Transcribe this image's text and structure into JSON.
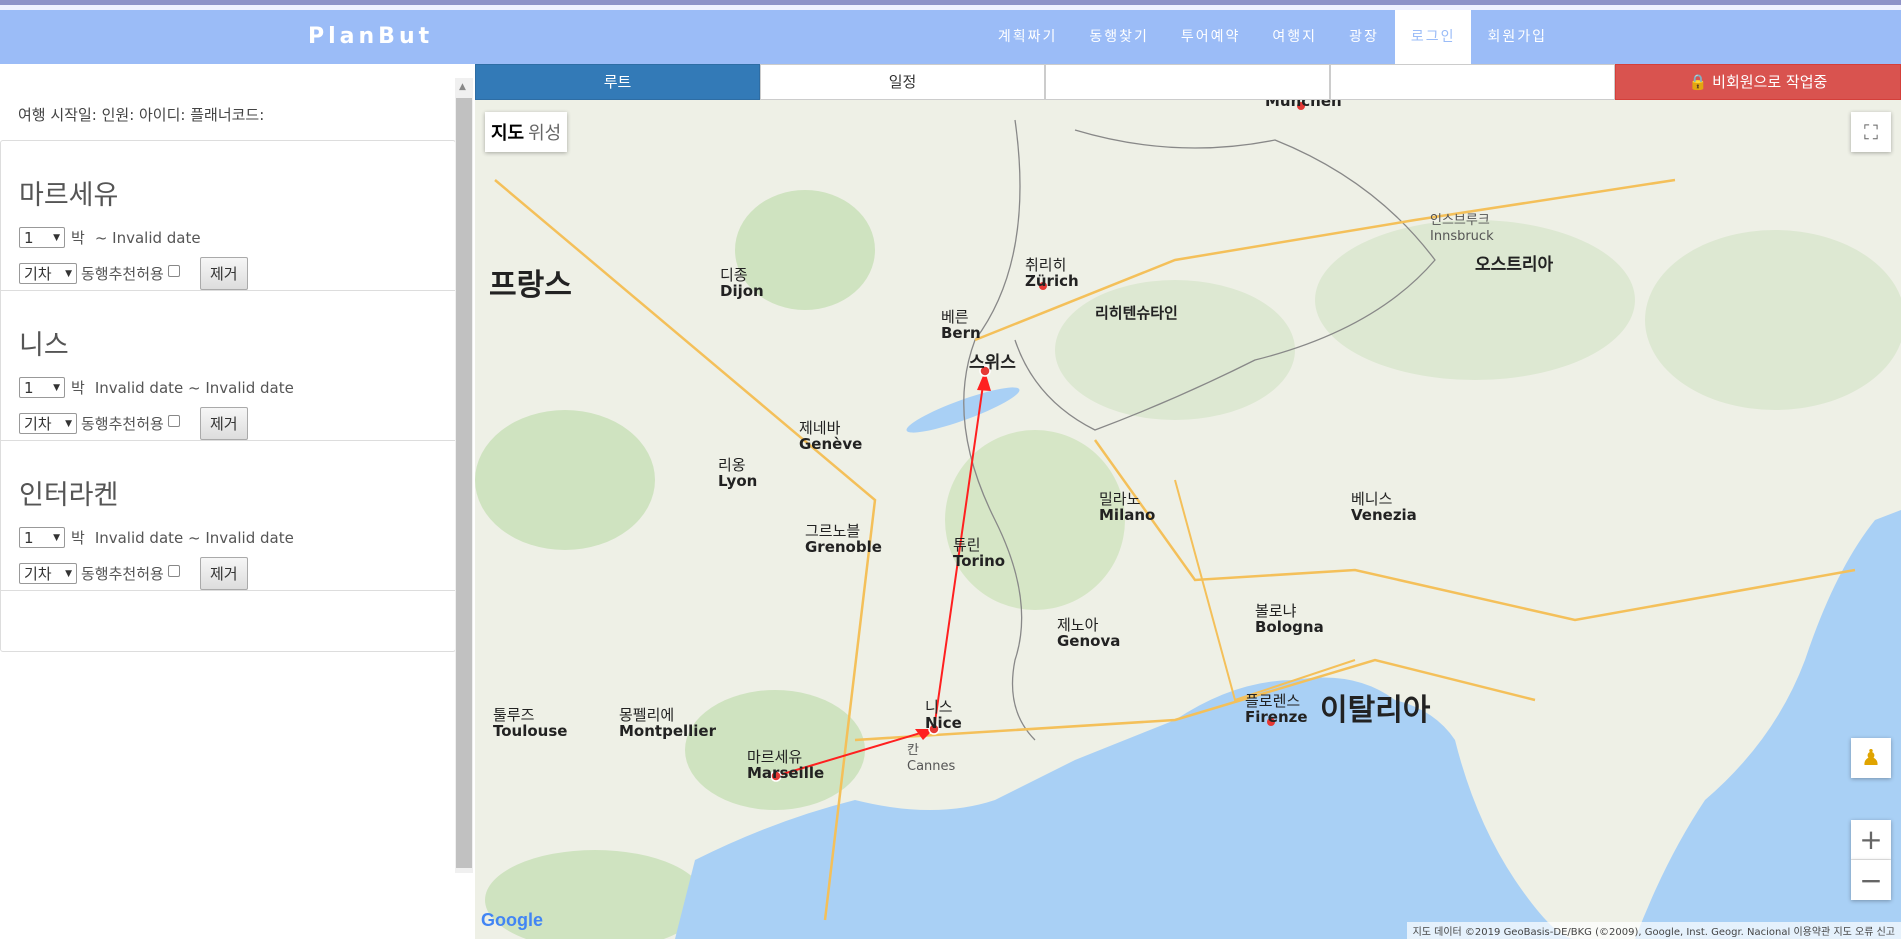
{
  "navbar": {
    "brand": "PlanBut",
    "items": [
      "계획짜기",
      "동행찾기",
      "투어예약",
      "여행지",
      "광장",
      "로그인",
      "회원가입"
    ],
    "active_item": "로그인"
  },
  "trip_info": {
    "text": "여행 시작일: 인원: 아이디: 플래너코드:"
  },
  "cities": [
    {
      "name": "마르세유",
      "nights": "1",
      "nights_unit": "박",
      "dates": "~ Invalid date",
      "transport": "기차",
      "companion_label": "동행추천허용",
      "companion_checked": false,
      "remove_label": "제거"
    },
    {
      "name": "니스",
      "nights": "1",
      "nights_unit": "박",
      "dates": "Invalid date ~ Invalid date",
      "transport": "기차",
      "companion_label": "동행추천허용",
      "companion_checked": false,
      "remove_label": "제거"
    },
    {
      "name": "인터라켄",
      "nights": "1",
      "nights_unit": "박",
      "dates": "Invalid date ~ Invalid date",
      "transport": "기차",
      "companion_label": "동행추천허용",
      "companion_checked": false,
      "remove_label": "제거"
    }
  ],
  "tabs": {
    "route": "루트",
    "schedule": "일정",
    "blank1": "",
    "blank2": "",
    "guest": "비회원으로 작업중"
  },
  "map": {
    "type_map": "지도",
    "type_satellite": "위성",
    "google": "Google",
    "attribution": "지도 데이터 ©2019 GeoBasis-DE/BKG (©2009), Google, Inst. Geogr. Nacional   이용약관   지도 오류 신고",
    "countries": {
      "france": "프랑스",
      "switzerland": "스위스",
      "italy": "이탈리아",
      "austria": "오스트리아",
      "liechtenstein": "리히텐슈타인"
    },
    "cities": {
      "marseille_ko": "마르세유",
      "marseille": "Marseille",
      "nice_ko": "니스",
      "nice": "Nice",
      "zurich_ko": "취리히",
      "zurich": "Zürich",
      "bern_ko": "베른",
      "bern": "Bern",
      "lyon_ko": "리옹",
      "lyon": "Lyon",
      "geneve_ko": "제네바",
      "geneve": "Genève",
      "torino_ko": "튜린",
      "torino": "Torino",
      "milano_ko": "밀라노",
      "milano": "Milano",
      "genova_ko": "제노아",
      "genova": "Genova",
      "firenze_ko": "플로렌스",
      "firenze": "Firenze",
      "montpellier_ko": "몽펠리에",
      "montpellier": "Montpellier",
      "toulouse_ko": "툴루즈",
      "toulouse": "Toulouse",
      "venezia_ko": "베니스",
      "venezia": "Venezia",
      "bologna_ko": "볼로냐",
      "bologna": "Bologna",
      "grenoble_ko": "그르노블",
      "grenoble": "Grenoble",
      "dijon_ko": "디종",
      "dijon": "Dijon",
      "munchen": "München",
      "innsbruck_ko": "인스브루크",
      "innsbruck": "Innsbruck",
      "cannes_ko": "칸",
      "cannes": "Cannes"
    },
    "route_stops": [
      "마르세유",
      "니스",
      "인터라켄"
    ]
  }
}
